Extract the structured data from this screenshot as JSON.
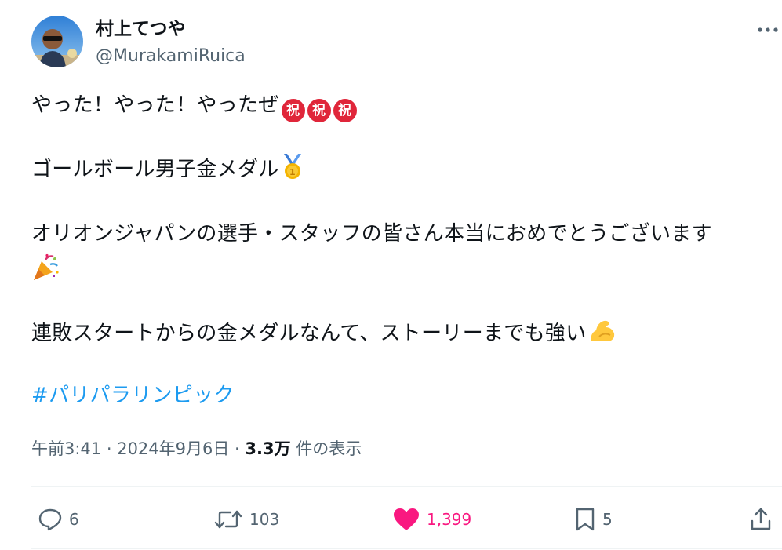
{
  "user": {
    "display_name": "村上てつや",
    "handle": "@MurakamiRuica"
  },
  "tweet": {
    "line1": "やった！やった！やったぜ",
    "iwai_glyph": "祝",
    "line2": "ゴールボール男子金メダル",
    "line3": "オリオンジャパンの選手・スタッフの皆さん本当におめでとうございます",
    "line4": "連敗スタートからの金メダルなんて、ストーリーまでも強い",
    "hashtag": "#パリパラリンピック",
    "emojis": [
      "circled-iwai-emoji",
      "gold-medal-emoji",
      "party-popper-emoji",
      "flexed-biceps-emoji"
    ]
  },
  "meta": {
    "time": "午前3:41",
    "sep1": " · ",
    "date": "2024年9月6日",
    "sep2": " · ",
    "views_count": "3.3万",
    "views_label": " 件の表示"
  },
  "actions": {
    "replies": "6",
    "reposts": "103",
    "likes": "1,399",
    "bookmarks": "5"
  },
  "colors": {
    "text": "#0f1419",
    "secondary": "#536471",
    "link": "#1d9bf0",
    "like": "#f91880",
    "divider": "#eff3f4"
  }
}
